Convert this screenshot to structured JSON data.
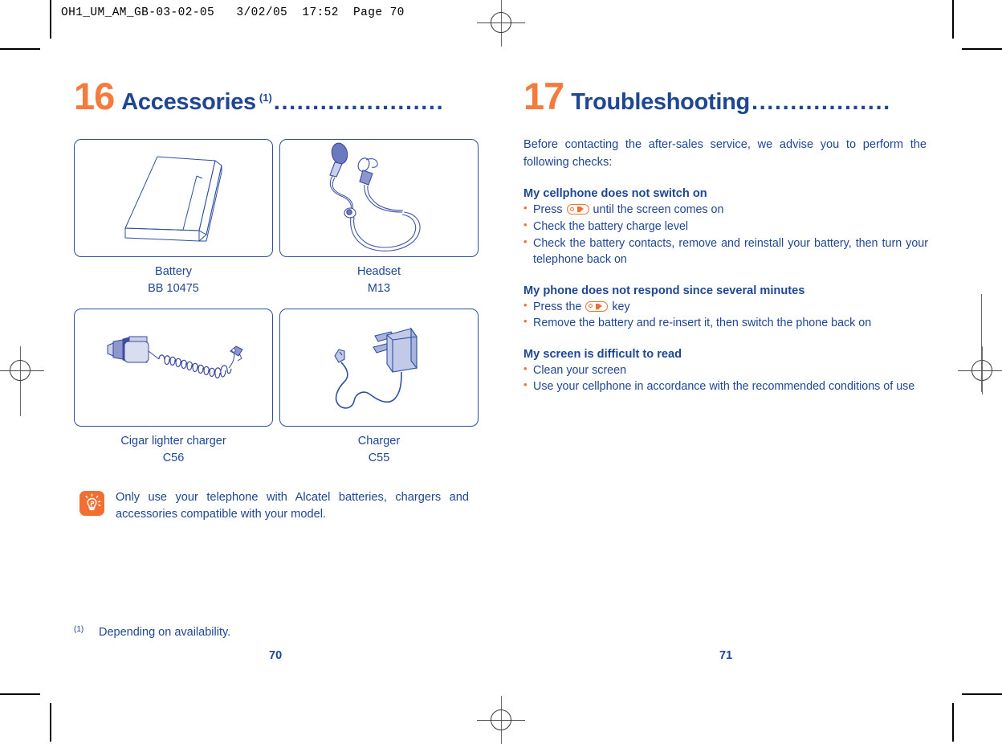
{
  "slug": "OH1_UM_AM_GB-03-02-05   3/02/05  17:52  Page 70",
  "colors": {
    "heading_number": "#F47B3D",
    "heading_text": "#1F4694",
    "body_text": "#1F4694",
    "bullet": "#F26F32",
    "note_icon_bg": "#F26F32",
    "box_border": "#2D4FA0"
  },
  "left_page": {
    "chapter": {
      "number": "16",
      "title": "Accessories",
      "superscript": "(1)",
      "dots": "......................"
    },
    "accessories": [
      {
        "icon": "battery-illustration",
        "name": "Battery",
        "model": "BB 10475"
      },
      {
        "icon": "headset-illustration",
        "name": "Headset",
        "model": "M13"
      },
      {
        "icon": "cigar-lighter-charger-illustration",
        "name": "Cigar lighter charger",
        "model": "C56"
      },
      {
        "icon": "charger-illustration",
        "name": "Charger",
        "model": "C55"
      }
    ],
    "note": {
      "icon": "lightbulb-icon",
      "text": "Only use your telephone with Alcatel batteries, chargers and accessories compatible with your model."
    },
    "footnote": {
      "mark": "(1)",
      "text": "Depending on availability."
    },
    "folio": "70"
  },
  "right_page": {
    "chapter": {
      "number": "17",
      "title": "Troubleshooting",
      "dots": ".................."
    },
    "intro": "Before contacting the after-sales service, we advise you to perform the following checks:",
    "sections": [
      {
        "heading": "My cellphone does not switch on",
        "bullets": [
          {
            "pre": "Press",
            "icon": "power-key-icon",
            "post": "until the screen comes on"
          },
          {
            "pre": "Check the battery charge level"
          },
          {
            "pre": "Check the battery contacts, remove and reinstall your battery, then turn your telephone back on"
          }
        ]
      },
      {
        "heading": "My phone does not respond since several minutes",
        "bullets": [
          {
            "pre": "Press the",
            "icon": "power-key-icon",
            "post": "key"
          },
          {
            "pre": "Remove the battery and re-insert it, then switch the phone back on"
          }
        ]
      },
      {
        "heading": "My screen is difficult to read",
        "bullets": [
          {
            "pre": "Clean your screen"
          },
          {
            "pre": "Use your cellphone in accordance with the recommended conditions of use"
          }
        ]
      }
    ],
    "folio": "71"
  }
}
